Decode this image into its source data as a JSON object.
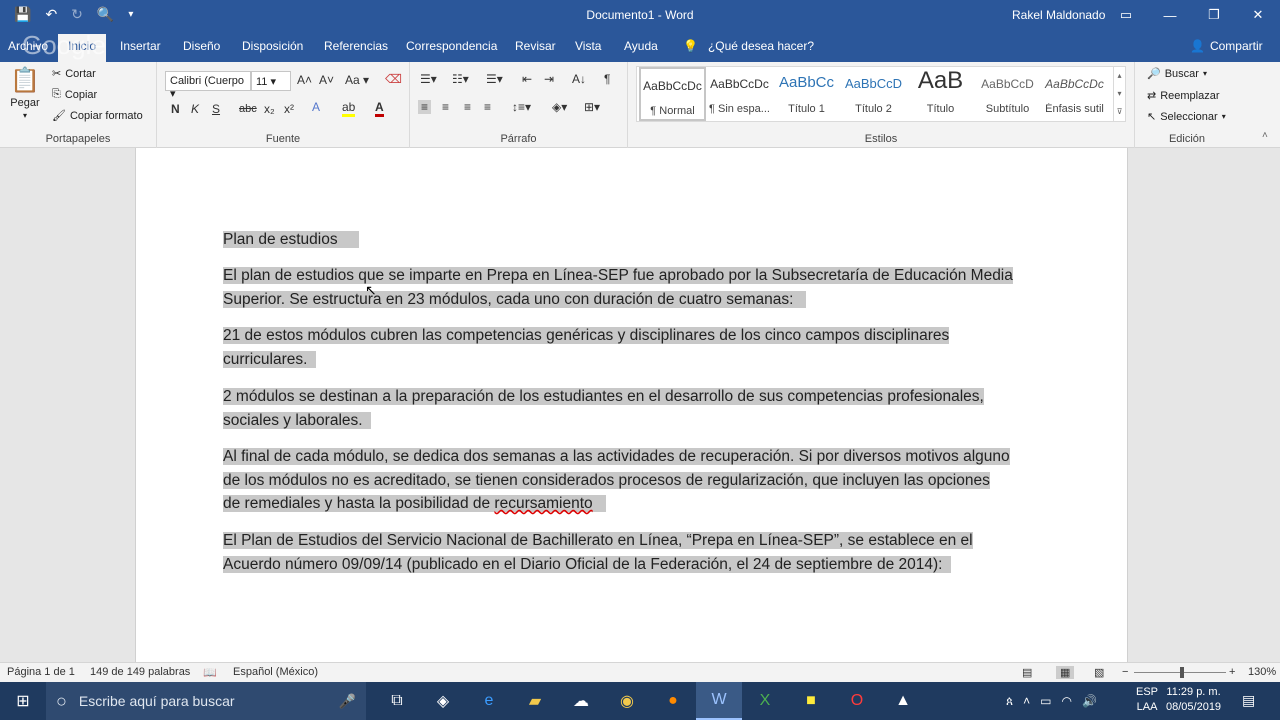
{
  "window": {
    "title": "Documento1 - Word",
    "user": "Rakel Maldonado",
    "google_watermark": "Google"
  },
  "tabs": [
    {
      "label": "Archivo"
    },
    {
      "label": "Inicio"
    },
    {
      "label": "Insertar"
    },
    {
      "label": "Diseño"
    },
    {
      "label": "Disposición"
    },
    {
      "label": "Referencias"
    },
    {
      "label": "Correspondencia"
    },
    {
      "label": "Revisar"
    },
    {
      "label": "Vista"
    },
    {
      "label": "Ayuda"
    }
  ],
  "tell_me": "¿Qué desea hacer?",
  "share": "Compartir",
  "ribbon": {
    "clipboard": {
      "label": "Portapapeles",
      "paste": "Pegar",
      "cut": "Cortar",
      "copy": "Copiar",
      "format_painter": "Copiar formato"
    },
    "font": {
      "label": "Fuente",
      "font_name": "Calibri (Cuerpo",
      "font_size": "11",
      "case": "Aa",
      "bold": "N",
      "italic": "K",
      "underline": "S",
      "strike": "abc",
      "subscript": "x₂",
      "superscript": "x²"
    },
    "paragraph": {
      "label": "Párrafo"
    },
    "styles": {
      "label": "Estilos",
      "items": [
        {
          "sample": "AaBbCcDc",
          "name": "¶ Normal"
        },
        {
          "sample": "AaBbCcDc",
          "name": "¶ Sin espa..."
        },
        {
          "sample": "AaBbCc",
          "name": "Título 1"
        },
        {
          "sample": "AaBbCcD",
          "name": "Título 2"
        },
        {
          "sample": "AaB",
          "name": "Título"
        },
        {
          "sample": "AaBbCcD",
          "name": "Subtítulo"
        },
        {
          "sample": "AaBbCcDc",
          "name": "Énfasis sutil"
        }
      ]
    },
    "editing": {
      "label": "Edición",
      "find": "Buscar",
      "replace": "Reemplazar",
      "select": "Seleccionar"
    }
  },
  "document": {
    "paragraphs": [
      {
        "text": "Plan de estudios"
      },
      {
        "line1": "El plan de estudios que se imparte en Prepa en Línea-SEP fue aprobado por la Subsecretaría de Educación Media",
        "line2": "Superior. Se estructura en 23 módulos, cada uno con duración de cuatro semanas:"
      },
      {
        "line1": "21 de estos módulos cubren las competencias genéricas y disciplinares de los cinco campos disciplinares",
        "line2": "curriculares."
      },
      {
        "line1": "2 módulos se destinan a la preparación de los estudiantes en el desarrollo de sus competencias profesionales,",
        "line2": "sociales y laborales."
      },
      {
        "line1": "Al final de cada módulo, se dedica dos semanas a las actividades de recuperación. Si por diversos motivos alguno",
        "line2": "de los módulos no es acreditado, se tienen considerados procesos de regularización, que incluyen las opciones",
        "line3_a": "de remediales y hasta la posibilidad de ",
        "line3_b": "recursamiento"
      },
      {
        "line1": "El Plan de Estudios del Servicio Nacional de Bachillerato en Línea, “Prepa en Línea-SEP”, se establece en el",
        "line2": "Acuerdo número 09/09/14 (publicado en el Diario Oficial de la Federación, el 24 de septiembre de 2014):"
      }
    ]
  },
  "status": {
    "page": "Página 1 de 1",
    "words": "149 de 149 palabras",
    "language": "Español (México)",
    "zoom": "130%"
  },
  "taskbar": {
    "search_placeholder": "Escribe aquí para buscar",
    "lang_top": "ESP",
    "lang_bottom": "LAA",
    "time": "11:29 p. m.",
    "date": "08/05/2019"
  }
}
